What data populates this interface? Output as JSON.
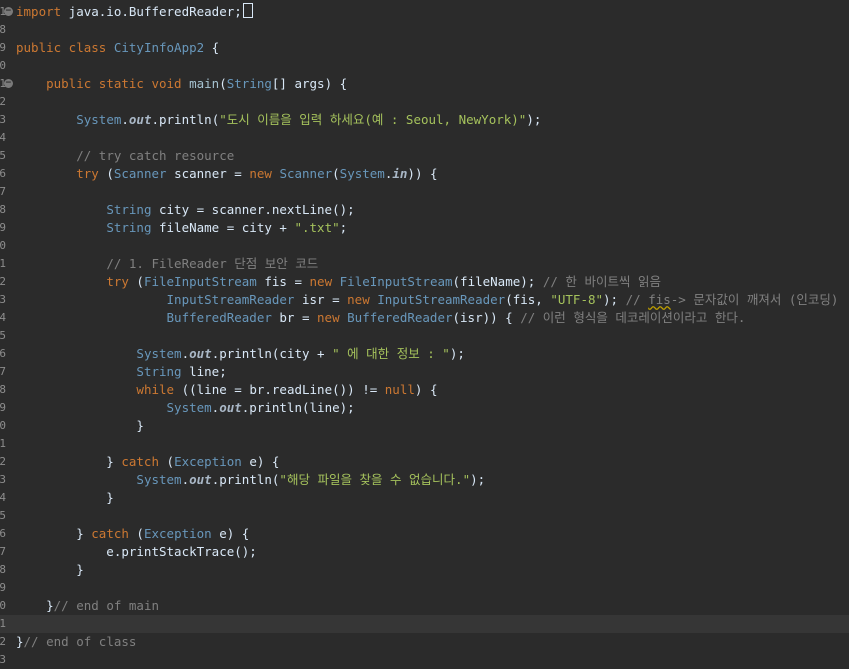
{
  "editor": {
    "current_line_index": 34,
    "lines": [
      {
        "n": "1",
        "fold": true,
        "tokens": [
          {
            "t": "kw",
            "v": "import"
          },
          {
            "t": "pl",
            "v": " java.io.BufferedReader;"
          }
        ],
        "caret": true
      },
      {
        "n": "8",
        "tokens": []
      },
      {
        "n": "9",
        "tokens": [
          {
            "t": "kw",
            "v": "public class "
          },
          {
            "t": "ty",
            "v": "CityInfoApp2"
          },
          {
            "t": "pl",
            "v": " {"
          }
        ]
      },
      {
        "n": "0",
        "tokens": []
      },
      {
        "n": "1",
        "fold": true,
        "tokens": [
          {
            "t": "pl",
            "v": "    "
          },
          {
            "t": "kw",
            "v": "public static void "
          },
          {
            "t": "fn",
            "v": "main"
          },
          {
            "t": "pl",
            "v": "("
          },
          {
            "t": "ty",
            "v": "String"
          },
          {
            "t": "pl",
            "v": "[] args) {"
          }
        ]
      },
      {
        "n": "2",
        "tokens": []
      },
      {
        "n": "3",
        "tokens": [
          {
            "t": "pl",
            "v": "        "
          },
          {
            "t": "ty",
            "v": "System"
          },
          {
            "t": "pl",
            "v": "."
          },
          {
            "t": "fi",
            "v": "out"
          },
          {
            "t": "pl",
            "v": ".println("
          },
          {
            "t": "st",
            "v": "\"도시 이름을 입력 하세요(예 : Seoul, NewYork)\""
          },
          {
            "t": "pl",
            "v": ");"
          }
        ]
      },
      {
        "n": "4",
        "tokens": []
      },
      {
        "n": "5",
        "tokens": [
          {
            "t": "pl",
            "v": "        "
          },
          {
            "t": "cm",
            "v": "// try catch resource"
          }
        ]
      },
      {
        "n": "6",
        "tokens": [
          {
            "t": "pl",
            "v": "        "
          },
          {
            "t": "kw",
            "v": "try"
          },
          {
            "t": "pl",
            "v": " ("
          },
          {
            "t": "ty",
            "v": "Scanner"
          },
          {
            "t": "pl",
            "v": " scanner = "
          },
          {
            "t": "kw",
            "v": "new "
          },
          {
            "t": "ty",
            "v": "Scanner"
          },
          {
            "t": "pl",
            "v": "("
          },
          {
            "t": "ty",
            "v": "System"
          },
          {
            "t": "pl",
            "v": "."
          },
          {
            "t": "fi",
            "v": "in"
          },
          {
            "t": "pl",
            "v": ")) {"
          }
        ]
      },
      {
        "n": "7",
        "tokens": []
      },
      {
        "n": "8",
        "tokens": [
          {
            "t": "pl",
            "v": "            "
          },
          {
            "t": "ty",
            "v": "String"
          },
          {
            "t": "pl",
            "v": " city = scanner.nextLine();"
          }
        ]
      },
      {
        "n": "9",
        "tokens": [
          {
            "t": "pl",
            "v": "            "
          },
          {
            "t": "ty",
            "v": "String"
          },
          {
            "t": "pl",
            "v": " fileName = city + "
          },
          {
            "t": "st",
            "v": "\".txt\""
          },
          {
            "t": "pl",
            "v": ";"
          }
        ]
      },
      {
        "n": "0",
        "tokens": []
      },
      {
        "n": "1",
        "tokens": [
          {
            "t": "pl",
            "v": "            "
          },
          {
            "t": "cm",
            "v": "// 1. FileReader 단점 보안 코드"
          }
        ]
      },
      {
        "n": "2",
        "tokens": [
          {
            "t": "pl",
            "v": "            "
          },
          {
            "t": "kw",
            "v": "try"
          },
          {
            "t": "pl",
            "v": " ("
          },
          {
            "t": "ty",
            "v": "FileInputStream"
          },
          {
            "t": "pl",
            "v": " fis = "
          },
          {
            "t": "kw",
            "v": "new "
          },
          {
            "t": "ty",
            "v": "FileInputStream"
          },
          {
            "t": "pl",
            "v": "(fileName); "
          },
          {
            "t": "cm",
            "v": "// 한 바이트씩 읽음"
          }
        ]
      },
      {
        "n": "3",
        "tokens": [
          {
            "t": "pl",
            "v": "                    "
          },
          {
            "t": "ty",
            "v": "InputStreamReader"
          },
          {
            "t": "pl",
            "v": " isr = "
          },
          {
            "t": "kw",
            "v": "new "
          },
          {
            "t": "ty",
            "v": "InputStreamReader"
          },
          {
            "t": "pl",
            "v": "(fis, "
          },
          {
            "t": "st",
            "v": "\"UTF-8\""
          },
          {
            "t": "pl",
            "v": "); "
          },
          {
            "t": "cm",
            "v": "// "
          },
          {
            "t": "cmsq",
            "v": "fis"
          },
          {
            "t": "cm",
            "v": "-> 문자값이 깨져서 (인코딩)"
          }
        ]
      },
      {
        "n": "4",
        "tokens": [
          {
            "t": "pl",
            "v": "                    "
          },
          {
            "t": "ty",
            "v": "BufferedReader"
          },
          {
            "t": "pl",
            "v": " br = "
          },
          {
            "t": "kw",
            "v": "new "
          },
          {
            "t": "ty",
            "v": "BufferedReader"
          },
          {
            "t": "pl",
            "v": "(isr)) { "
          },
          {
            "t": "cm",
            "v": "// 이런 형식을 데코레이션이라고 한다."
          }
        ]
      },
      {
        "n": "5",
        "tokens": []
      },
      {
        "n": "6",
        "tokens": [
          {
            "t": "pl",
            "v": "                "
          },
          {
            "t": "ty",
            "v": "System"
          },
          {
            "t": "pl",
            "v": "."
          },
          {
            "t": "fi",
            "v": "out"
          },
          {
            "t": "pl",
            "v": ".println(city + "
          },
          {
            "t": "st",
            "v": "\" 에 대한 정보 : \""
          },
          {
            "t": "pl",
            "v": ");"
          }
        ]
      },
      {
        "n": "7",
        "tokens": [
          {
            "t": "pl",
            "v": "                "
          },
          {
            "t": "ty",
            "v": "String"
          },
          {
            "t": "pl",
            "v": " line;"
          }
        ]
      },
      {
        "n": "8",
        "tokens": [
          {
            "t": "pl",
            "v": "                "
          },
          {
            "t": "kw",
            "v": "while"
          },
          {
            "t": "pl",
            "v": " ((line = br.readLine()) != "
          },
          {
            "t": "kw",
            "v": "null"
          },
          {
            "t": "pl",
            "v": ") {"
          }
        ]
      },
      {
        "n": "9",
        "tokens": [
          {
            "t": "pl",
            "v": "                    "
          },
          {
            "t": "ty",
            "v": "System"
          },
          {
            "t": "pl",
            "v": "."
          },
          {
            "t": "fi",
            "v": "out"
          },
          {
            "t": "pl",
            "v": ".println(line);"
          }
        ]
      },
      {
        "n": "0",
        "tokens": [
          {
            "t": "pl",
            "v": "                }"
          }
        ]
      },
      {
        "n": "1",
        "tokens": []
      },
      {
        "n": "2",
        "tokens": [
          {
            "t": "pl",
            "v": "            } "
          },
          {
            "t": "kw",
            "v": "catch"
          },
          {
            "t": "pl",
            "v": " ("
          },
          {
            "t": "ty",
            "v": "Exception"
          },
          {
            "t": "pl",
            "v": " e) {"
          }
        ]
      },
      {
        "n": "3",
        "tokens": [
          {
            "t": "pl",
            "v": "                "
          },
          {
            "t": "ty",
            "v": "System"
          },
          {
            "t": "pl",
            "v": "."
          },
          {
            "t": "fi",
            "v": "out"
          },
          {
            "t": "pl",
            "v": ".println("
          },
          {
            "t": "st",
            "v": "\"해당 파일을 찾을 수 없습니다.\""
          },
          {
            "t": "pl",
            "v": ");"
          }
        ]
      },
      {
        "n": "4",
        "tokens": [
          {
            "t": "pl",
            "v": "            }"
          }
        ]
      },
      {
        "n": "5",
        "tokens": []
      },
      {
        "n": "6",
        "tokens": [
          {
            "t": "pl",
            "v": "        } "
          },
          {
            "t": "kw",
            "v": "catch"
          },
          {
            "t": "pl",
            "v": " ("
          },
          {
            "t": "ty",
            "v": "Exception"
          },
          {
            "t": "pl",
            "v": " e) {"
          }
        ]
      },
      {
        "n": "7",
        "tokens": [
          {
            "t": "pl",
            "v": "            e.printStackTrace();"
          }
        ]
      },
      {
        "n": "8",
        "tokens": [
          {
            "t": "pl",
            "v": "        }"
          }
        ]
      },
      {
        "n": "9",
        "tokens": []
      },
      {
        "n": "0",
        "tokens": [
          {
            "t": "pl",
            "v": "    }"
          },
          {
            "t": "cm",
            "v": "// end of main"
          }
        ]
      },
      {
        "n": "1",
        "tokens": []
      },
      {
        "n": "2",
        "tokens": [
          {
            "t": "pl",
            "v": "}"
          },
          {
            "t": "cm",
            "v": "// end of class"
          }
        ]
      },
      {
        "n": "3",
        "tokens": []
      }
    ],
    "colors": {
      "background": "#2b2b2b",
      "current_line": "#363636",
      "keyword": "#cc7832",
      "type": "#6897bb",
      "string": "#a5c25c",
      "comment": "#808080",
      "plain": "#d9e8f7"
    }
  }
}
